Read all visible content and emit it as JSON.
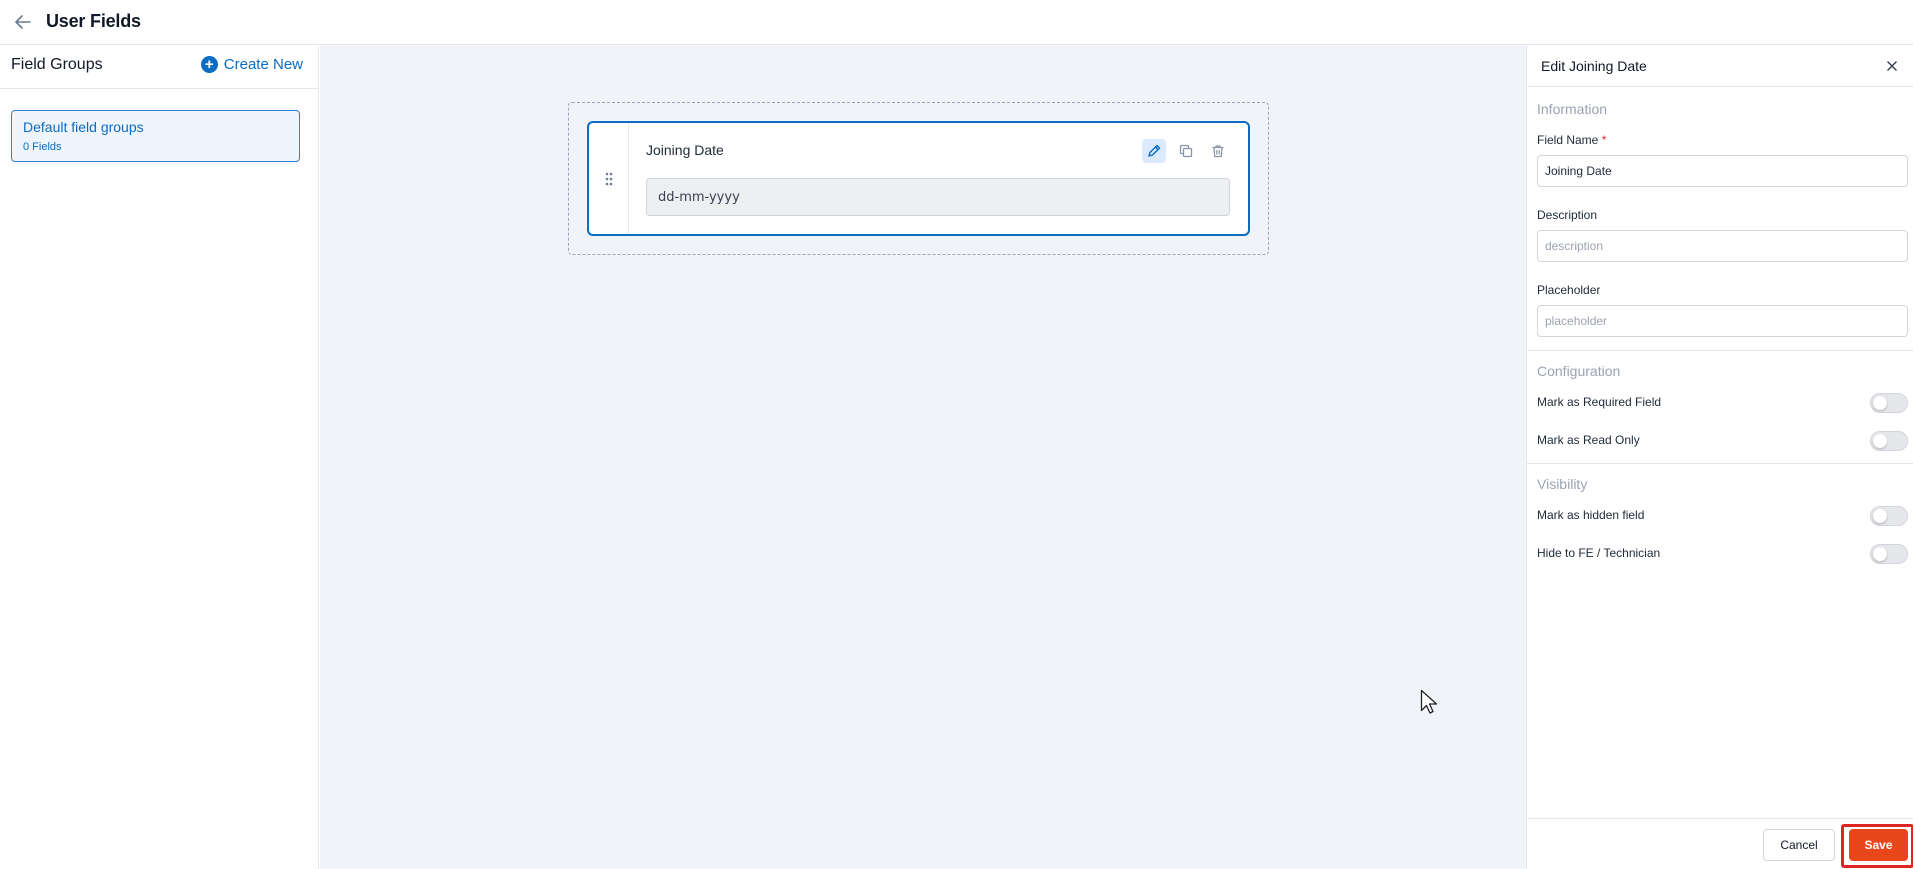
{
  "header": {
    "title": "User Fields",
    "back_icon": "arrow-left-icon"
  },
  "left_panel": {
    "title": "Field Groups",
    "create_new_label": "Create New",
    "groups": [
      {
        "name": "Default field groups",
        "count": "0 Fields"
      }
    ]
  },
  "canvas": {
    "field": {
      "label": "Joining Date",
      "preview_value": "dd-mm-yyyy"
    }
  },
  "right_panel": {
    "title": "Edit Joining Date",
    "information": {
      "title": "Information",
      "field_name_label": "Field Name",
      "required_mark": "*",
      "field_name_value": "Joining Date",
      "description_label": "Description",
      "description_placeholder": "description",
      "placeholder_label": "Placeholder",
      "placeholder_placeholder": "placeholder"
    },
    "configuration": {
      "title": "Configuration",
      "toggles": [
        {
          "label": "Mark as Required Field",
          "on": false
        },
        {
          "label": "Mark as Read Only",
          "on": false
        }
      ]
    },
    "visibility": {
      "title": "Visibility",
      "toggles": [
        {
          "label": "Mark as hidden field",
          "on": false
        },
        {
          "label": "Hide to FE / Technician",
          "on": false
        }
      ]
    },
    "footer": {
      "cancel_label": "Cancel",
      "save_label": "Save"
    }
  },
  "colors": {
    "accent": "#0b6cc4",
    "save": "#e8471c",
    "highlight": "#e02424",
    "canvas_bg": "#f0f3f8"
  }
}
